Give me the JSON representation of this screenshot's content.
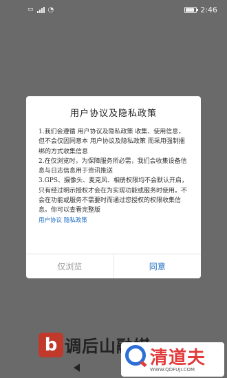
{
  "statusbar": {
    "time": "2:46",
    "icons": [
      "sim-icon",
      "signal-icon",
      "wifi-icon",
      "battery-icon"
    ]
  },
  "dialog": {
    "title": "用户协议及隐私政策",
    "paragraphs": [
      "1.我们会遵循 用户协议及隐私政策 收集、使用信息，但不会仅因同意本 用户协议及隐私政策 而采用强制捆绑的方式收集信息",
      "2.在仅浏览时，为保障服务所必需，我们会收集设备信息与日志信息用于资讯推送",
      "3.GPS、摄像头、麦克风、相册权限均不会默认开启，只有经过明示授权才会在为实现功能或服务时使用。不会在功能或服务不需要时而通过您授权的权限收集信息。你可以查看完整版"
    ],
    "link_text": "用户协议 隐私政策",
    "buttons": {
      "browse": "仅浏览",
      "agree": "同意"
    }
  },
  "app": {
    "logo_letter": "b",
    "name_partial": "调后山融媒"
  },
  "watermark": {
    "brand": "清道夫",
    "url": "WWW.QDFUJI.COM"
  },
  "colors": {
    "overlay": "#6a6a6a",
    "link": "#1f6fc4",
    "brand_red": "#e23b3b"
  }
}
